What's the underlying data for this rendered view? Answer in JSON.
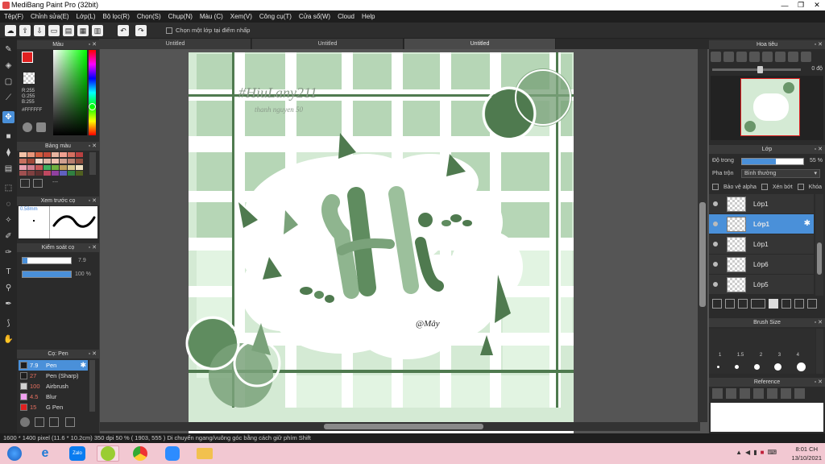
{
  "window": {
    "title": "MediBang Paint Pro (32bit)",
    "controls": [
      "—",
      "❐",
      "✕"
    ]
  },
  "menu": [
    "Tệp(F)",
    "Chỉnh sửa(E)",
    "Lớp(L)",
    "Bộ lọc(R)",
    "Chọn(S)",
    "Chụp(N)",
    "Màu (C)",
    "Xem(V)",
    "Công cụ(T)",
    "Cửa sổ(W)",
    "Cloud",
    "Help"
  ],
  "toolbar": {
    "select_layer_label": "Chọn một lớp tại điểm nhấp"
  },
  "color_panel": {
    "title": "Màu",
    "r_label": "R:255",
    "g_label": "G:255",
    "b_label": "B:255",
    "hex": "#FFFFFF",
    "primary_color": "#e02020",
    "secondary_color": "#ffffff"
  },
  "palette_panel": {
    "title": "Bảng màu",
    "swatches": [
      "#f4c2a8",
      "#e8967a",
      "#d45d3e",
      "#c44a3a",
      "#e8b4a0",
      "#f0a090",
      "#d47060",
      "#b84040",
      "#c87060",
      "#a04838",
      "#f0d8c8",
      "#e0b8a8",
      "#f0c0b0",
      "#d0a090",
      "#b88070",
      "#905040",
      "#e8a0b0",
      "#d08090",
      "#c85a5a",
      "#40b060",
      "#70b040",
      "#c0a060",
      "#d8c890",
      "#f0e0c0",
      "#a05050",
      "#804040",
      "#603030",
      "#c04860",
      "#9040a0",
      "#6060c0",
      "#308040",
      "#506020"
    ],
    "dropdown": "---"
  },
  "brush_preview_panel": {
    "title": "Xem trước cọ",
    "size_label": "0.58mm"
  },
  "brush_control_panel": {
    "title": "Kiểm soát cọ",
    "size_value": "7.9",
    "opacity_value": "100 %",
    "opacity_fraction": 1.0
  },
  "brush_list_panel": {
    "title": "Cọ: Pen",
    "items": [
      {
        "size": "7.9",
        "name": "Pen",
        "color": "#1e1e1e",
        "active": true
      },
      {
        "size": "27",
        "name": "Pen (Sharp)",
        "color": "#1e1e1e",
        "active": false
      },
      {
        "size": "100",
        "name": "Airbrush",
        "color": "#d0d0d0",
        "active": false
      },
      {
        "size": "4.5",
        "name": "Blur",
        "color": "#f0a0f0",
        "active": false
      },
      {
        "size": "15",
        "name": "G Pen",
        "color": "#e02020",
        "active": false
      }
    ]
  },
  "tabs": [
    "Untitled",
    "Untitled",
    "Untitled"
  ],
  "artwork": {
    "title_text": "Hi",
    "watermark_line1": "#HiuLany211",
    "watermark_line2": "thanh nguyen 50",
    "signature": "@Mây"
  },
  "navigator_panel": {
    "title": "Hoa tiêu",
    "rotation": "0 độ"
  },
  "layer_panel": {
    "title": "Lớp",
    "opacity_label": "Độ trong",
    "opacity_value": "55 %",
    "opacity_fraction": 0.55,
    "blend_label": "Pha trộn",
    "blend_value": "Bình thường",
    "protect_alpha": "Bảo vệ alpha",
    "clipping": "Xén bớt",
    "lock": "Khóa",
    "layers": [
      {
        "name": "Lớp1",
        "active": false
      },
      {
        "name": "Lớp1",
        "active": true
      },
      {
        "name": "Lớp1",
        "active": false
      },
      {
        "name": "Lớp6",
        "active": false
      },
      {
        "name": "Lớp5",
        "active": false
      }
    ]
  },
  "brush_size_panel": {
    "title": "Brush Size",
    "sizes_row1": [
      "1",
      "1.5",
      "2",
      "3",
      "4"
    ]
  },
  "reference_panel": {
    "title": "Reference"
  },
  "statusbar": {
    "text": "1600 * 1400 pixel   (11.6 * 10.2cm)   350 dpi   50 %   ( 1903, 555 )   Di chuyển ngang/vuông góc bằng cách giữ phím Shift"
  },
  "taskbar": {
    "time": "8:01 CH",
    "date": "13/10/2021",
    "zalo_label": "Zalo"
  }
}
